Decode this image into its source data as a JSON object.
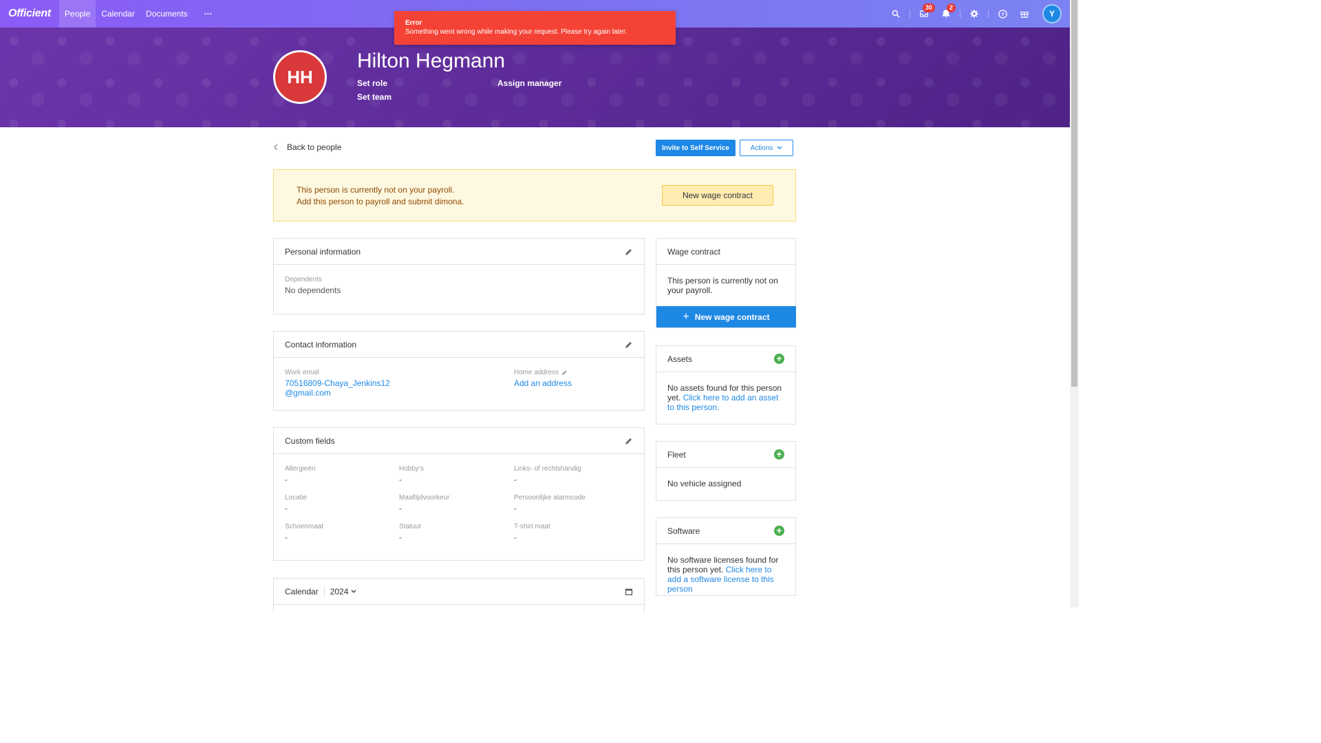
{
  "topbar": {
    "logo": "Officient",
    "nav": [
      "People",
      "Calendar",
      "Documents"
    ],
    "more": "···",
    "inbox_count": "30",
    "notifications_count": "2",
    "user_initial": "Y"
  },
  "toast": {
    "title": "Error",
    "message": "Something went wrong while making your request. Please try again later."
  },
  "profile": {
    "initials": "HH",
    "name": "Hilton Hegmann",
    "set_role": "Set role",
    "assign_manager": "Assign manager",
    "set_team": "Set team"
  },
  "toolbar": {
    "back": "Back to people",
    "invite": "Invite to Self Service",
    "actions": "Actions"
  },
  "payroll_alert": {
    "title": "This person is currently not on your payroll.",
    "subtitle": "Add this person to payroll and submit dimona.",
    "button": "New wage contract"
  },
  "personal": {
    "header": "Personal information",
    "dependents_label": "Dependents",
    "dependents_value": "No dependents"
  },
  "contact": {
    "header": "Contact information",
    "work_email_label": "Work email",
    "work_email_line1": "70516809-Chaya_Jenkins12",
    "work_email_line2": "@gmail.com",
    "home_address_label": "Home address",
    "home_address_link": "Add an address"
  },
  "custom": {
    "header": "Custom fields",
    "fields": [
      {
        "label": "Allergieën",
        "value": "-"
      },
      {
        "label": "Hobby's",
        "value": "-"
      },
      {
        "label": "Links- of rechtshandig",
        "value": "-"
      },
      {
        "label": "Locatie",
        "value": "-"
      },
      {
        "label": "Maaltijdvoorkeur",
        "value": "-"
      },
      {
        "label": "Persoonlijke alarmcode",
        "value": "-"
      },
      {
        "label": "Schoenmaat",
        "value": "-"
      },
      {
        "label": "Statuut",
        "value": "-"
      },
      {
        "label": "T-shirt maat",
        "value": "-"
      }
    ]
  },
  "calendar": {
    "header": "Calendar",
    "year": "2024"
  },
  "wage": {
    "header": "Wage contract",
    "text": "This person is currently not on your payroll.",
    "button": "New wage contract"
  },
  "assets": {
    "header": "Assets",
    "text": "No assets found for this person yet.",
    "link": "Click here to add an asset to this person."
  },
  "fleet": {
    "header": "Fleet",
    "text": "No vehicle assigned"
  },
  "software": {
    "header": "Software",
    "text": "No software licenses found for this person yet.",
    "link": "Click here to add a software license to this person"
  }
}
